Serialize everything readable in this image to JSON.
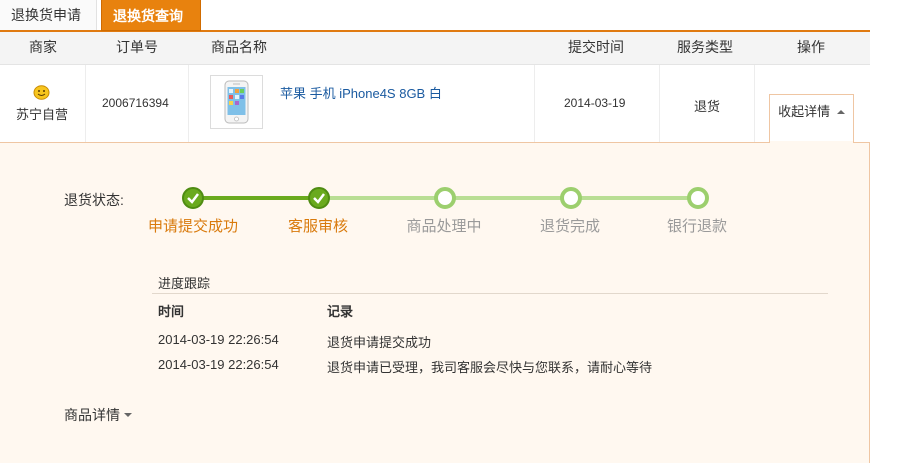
{
  "tabs": [
    {
      "label": "退换货申请"
    },
    {
      "label": "退换货查询"
    }
  ],
  "table": {
    "headers": [
      "商家",
      "订单号",
      "商品名称",
      "提交时间",
      "服务类型",
      "操作"
    ],
    "row": {
      "merchant": "苏宁自营",
      "order_no": "2006716394",
      "product": "苹果 手机 iPhone4S 8GB 白",
      "submit_time": "2014-03-19",
      "service_type": "退货",
      "action": "收起详情"
    }
  },
  "status": {
    "label": "退货状态:",
    "steps": [
      {
        "label": "申请提交成功",
        "done": true
      },
      {
        "label": "客服审核",
        "done": true
      },
      {
        "label": "商品处理中",
        "done": false
      },
      {
        "label": "退货完成",
        "done": false
      },
      {
        "label": "银行退款",
        "done": false
      }
    ]
  },
  "progress": {
    "title": "进度跟踪",
    "col_time": "时间",
    "col_record": "记录",
    "rows": [
      {
        "time": "2014-03-19 22:26:54",
        "record": "退货申请提交成功"
      },
      {
        "time": "2014-03-19 22:26:54",
        "record": "退货申请已受理，我司客服会尽快与您联系，请耐心等待"
      }
    ]
  },
  "goods_detail": "商品详情",
  "colors": {
    "accent": "#e8820e",
    "done": "#6aaa1e",
    "link": "#1a5aa0"
  }
}
